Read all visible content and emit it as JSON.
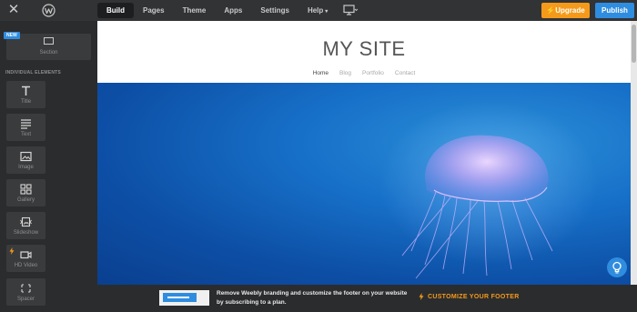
{
  "topbar": {
    "close_icon": "close-icon",
    "logo_icon": "weebly-logo-icon",
    "nav": [
      {
        "label": "Build",
        "active": true
      },
      {
        "label": "Pages",
        "active": false
      },
      {
        "label": "Theme",
        "active": false
      },
      {
        "label": "Apps",
        "active": false
      },
      {
        "label": "Settings",
        "active": false
      },
      {
        "label": "Help",
        "active": false,
        "dropdown": true
      }
    ],
    "device_icon": "desktop-preview-icon",
    "upgrade_label": "Upgrade",
    "publish_label": "Publish"
  },
  "sidebar": {
    "new_badge": "NEW",
    "section_label": "Section",
    "elements_header": "INDIVIDUAL ELEMENTS",
    "elements": [
      {
        "label": "Title",
        "icon": "title-icon"
      },
      {
        "label": "Text",
        "icon": "text-icon"
      },
      {
        "label": "Image",
        "icon": "image-icon"
      },
      {
        "label": "Gallery",
        "icon": "gallery-icon"
      },
      {
        "label": "Slideshow",
        "icon": "slideshow-icon"
      },
      {
        "label": "HD Video",
        "icon": "video-icon",
        "premium": true
      },
      {
        "label": "Spacer",
        "icon": "spacer-icon"
      }
    ]
  },
  "site": {
    "title": "MY SITE",
    "nav": [
      {
        "label": "Home",
        "active": true
      },
      {
        "label": "Blog",
        "active": false
      },
      {
        "label": "Portfolio",
        "active": false
      },
      {
        "label": "Contact",
        "active": false
      }
    ]
  },
  "footer_banner": {
    "message": "Remove Weebly branding and customize the footer on your website by subscribing to a plan.",
    "cta_label": "CUSTOMIZE YOUR FOOTER"
  },
  "colors": {
    "accent_orange": "#f49a1a",
    "accent_blue": "#2f8de0",
    "toolbar_bg": "#323335",
    "sidebar_bg": "#2b2c2e"
  }
}
